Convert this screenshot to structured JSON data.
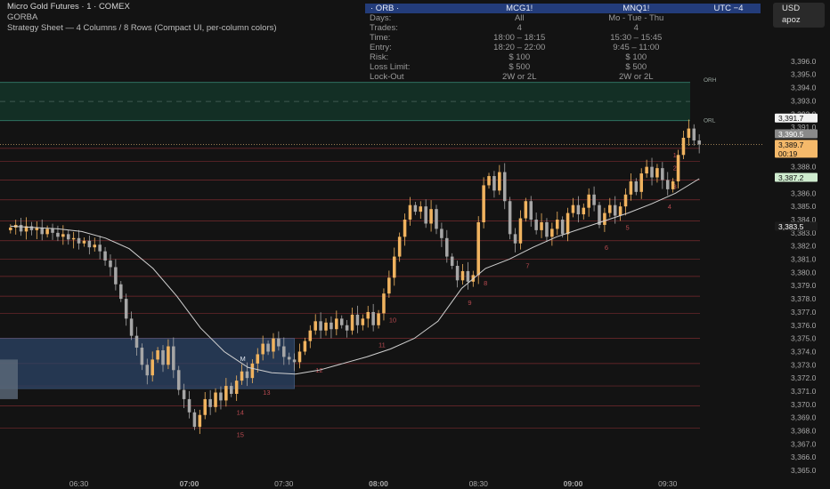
{
  "header": {
    "title": "Micro Gold Futures · 1 · COMEX",
    "subtitle": "GORBA",
    "sheet_line": "Strategy Sheet — 4 Columns / 8 Rows (Compact UI, per-column colors)"
  },
  "currency_button": {
    "currency": "USD",
    "label": "apoz"
  },
  "strategy_table": {
    "header": [
      "· ORB ·",
      "MCG1!",
      "MNQ1!",
      "UTC −4"
    ],
    "rows": [
      {
        "label": "Days:",
        "col1": "All",
        "col2": "Mo - Tue - Thu"
      },
      {
        "label": "Trades:",
        "col1": "4",
        "col2": "4"
      },
      {
        "label": "Time:",
        "col1": "18:00 – 18:15",
        "col2": "15:30 – 15:45"
      },
      {
        "label": "Entry:",
        "col1": "18:20 – 22:00",
        "col2": "9:45 – 11:00"
      },
      {
        "label": "Risk:",
        "col1": "$ 100",
        "col2": "$ 100"
      },
      {
        "label": "Loss Limit:",
        "col1": "$ 500",
        "col2": "$ 500"
      },
      {
        "label": "Lock-Out",
        "col1": "2W or 2L",
        "col2": "2W or 2L"
      }
    ]
  },
  "colors": {
    "up": "#f0b35f",
    "down": "#a6a6a6",
    "ma": "#d0d0d0",
    "level": "#8a2f33",
    "orb_fill": "#143328",
    "orb_line": "#2e7060",
    "zone_fill": "#2c4466"
  },
  "chart_data": {
    "type": "candlestick",
    "title": "Micro Gold Futures · 1 · COMEX",
    "ylim": [
      3364.4,
      3400.1
    ],
    "y_ticks": [
      "3,365.0",
      "3,366.0",
      "3,367.0",
      "3,368.0",
      "3,369.0",
      "3,370.0",
      "3,371.0",
      "3,372.0",
      "3,373.0",
      "3,374.0",
      "3,375.0",
      "3,376.0",
      "3,377.0",
      "3,378.0",
      "3,379.0",
      "3,380.0",
      "3,381.0",
      "3,382.0",
      "3,383.0",
      "3,384.0",
      "3,385.0",
      "3,386.0",
      "3,388.0",
      "3,391.0",
      "3,392.0",
      "3,393.0",
      "3,394.0",
      "3,395.0",
      "3,396.0"
    ],
    "y_tick_values": [
      3365,
      3366,
      3367,
      3368,
      3369,
      3370,
      3371,
      3372,
      3373,
      3374,
      3375,
      3376,
      3377,
      3378,
      3379,
      3380,
      3381,
      3382,
      3383,
      3384,
      3385,
      3386,
      3388,
      3391,
      3392,
      3393,
      3394,
      3395,
      3396
    ],
    "x_ticks": [
      "06:30",
      "07:00",
      "07:30",
      "08:00",
      "08:30",
      "09:00",
      "09:30"
    ],
    "x_tick_bold": [
      false,
      true,
      false,
      true,
      false,
      true,
      false
    ],
    "price_labels": [
      {
        "text": "3,391.7",
        "value": 3391.7,
        "style": "white"
      },
      {
        "text": "3,390.5",
        "value": 3390.5,
        "style": "gray"
      },
      {
        "text": "3,389.7",
        "value": 3389.7,
        "style": "orange",
        "sub": "00:19"
      },
      {
        "text": "3,387.2",
        "value": 3387.2,
        "style": "green"
      },
      {
        "text": "3,383.5",
        "value": 3383.5,
        "style": "dark"
      }
    ],
    "orb": {
      "high": 3394.4,
      "low": 3391.5,
      "high_label": "ORH",
      "low_label": "ORL"
    },
    "zone": {
      "top": 3375.0,
      "bottom": 3371.2,
      "t_start": 0,
      "t_end": 54
    },
    "zone_left_box": {
      "top": 3373.4,
      "bottom": 3370.4
    },
    "levels": [
      {
        "label": "1",
        "value": 3389.4,
        "t_label": 126
      },
      {
        "label": "2",
        "value": 3388.4,
        "t_label": 126
      },
      {
        "label": "3",
        "value": 3387.0,
        "t_label": 126
      },
      {
        "label": "4",
        "value": 3385.5,
        "t_label": 125
      },
      {
        "label": "5",
        "value": 3383.9,
        "t_label": 117
      },
      {
        "label": "6",
        "value": 3382.4,
        "t_label": 113
      },
      {
        "label": "7",
        "value": 3381.0,
        "t_label": 98
      },
      {
        "label": "8",
        "value": 3379.7,
        "t_label": 90
      },
      {
        "label": "9",
        "value": 3378.2,
        "t_label": 87
      },
      {
        "label": "10",
        "value": 3376.9,
        "t_label": 72
      },
      {
        "label": "11",
        "value": 3375.0,
        "t_label": 70
      },
      {
        "label": "12",
        "value": 3373.1,
        "t_label": 58
      },
      {
        "label": "13",
        "value": 3371.4,
        "t_label": 48
      },
      {
        "label": "14",
        "value": 3369.9,
        "t_label": 43
      },
      {
        "label": "15",
        "value": 3368.2,
        "t_label": 43
      }
    ],
    "zone_marker": "M",
    "t_range": [
      -2,
      143
    ],
    "x_tick_t": [
      13,
      34,
      52,
      70,
      89,
      107,
      125
    ],
    "closes": [
      3383.4,
      3383.6,
      3383.1,
      3383.5,
      3383.2,
      3383.4,
      3382.9,
      3383.3,
      3383.0,
      3382.7,
      3382.9,
      3382.5,
      3382.6,
      3382.2,
      3382.4,
      3381.9,
      3382.1,
      3381.6,
      3380.9,
      3380.4,
      3379.1,
      3378.0,
      3376.5,
      3375.2,
      3374.3,
      3373.0,
      3372.2,
      3373.4,
      3374.1,
      3373.0,
      3374.4,
      3372.6,
      3371.1,
      3370.4,
      3369.4,
      3368.3,
      3369.2,
      3370.4,
      3369.8,
      3370.9,
      3370.3,
      3371.4,
      3370.8,
      3371.8,
      3372.5,
      3372.0,
      3373.1,
      3373.8,
      3374.6,
      3374.0,
      3375.0,
      3374.4,
      3373.6,
      3373.4,
      3373.2,
      3374.0,
      3374.8,
      3375.6,
      3376.3,
      3375.6,
      3376.2,
      3375.7,
      3376.5,
      3376.0,
      3375.6,
      3376.8,
      3376.0,
      3376.5,
      3377.0,
      3376.0,
      3376.9,
      3378.4,
      3379.6,
      3381.2,
      3382.7,
      3384.0,
      3385.1,
      3384.6,
      3385.0,
      3383.7,
      3384.8,
      3383.3,
      3382.6,
      3381.2,
      3380.5,
      3379.4,
      3380.1,
      3379.3,
      3379.8,
      3383.8,
      3386.6,
      3387.3,
      3386.2,
      3387.6,
      3385.4,
      3382.9,
      3382.2,
      3384.1,
      3385.4,
      3384.0,
      3383.2,
      3383.8,
      3382.7,
      3383.3,
      3384.0,
      3382.9,
      3384.5,
      3385.1,
      3384.4,
      3384.9,
      3385.9,
      3385.1,
      3383.6,
      3384.5,
      3385.1,
      3384.3,
      3385.0,
      3385.9,
      3386.9,
      3386.1,
      3387.5,
      3388.0,
      3387.2,
      3387.9,
      3387.0,
      3386.3,
      3386.9,
      3388.9,
      3390.2,
      3390.9,
      3390.0,
      3389.7
    ],
    "ma": [
      3383.5,
      3383.4,
      3383.3,
      3383.1,
      3382.6,
      3381.8,
      3380.3,
      3378.2,
      3375.8,
      3374.0,
      3372.8,
      3372.4,
      3372.3,
      3372.6,
      3373.1,
      3373.6,
      3374.2,
      3375.0,
      3376.3,
      3378.8,
      3380.3,
      3381.0,
      3381.9,
      3382.7,
      3383.3,
      3383.9,
      3384.5,
      3385.2,
      3386.0,
      3387.1
    ]
  }
}
